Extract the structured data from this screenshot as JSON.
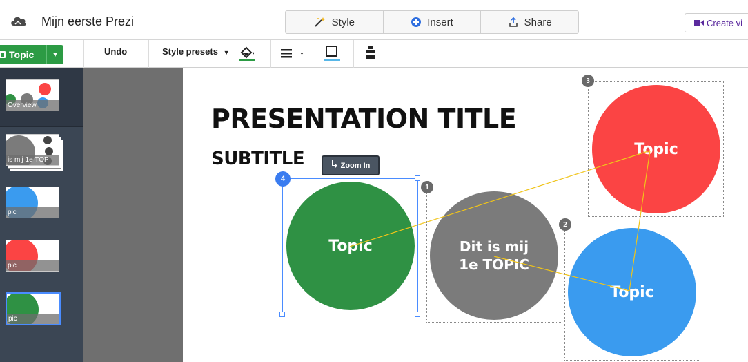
{
  "header": {
    "doc_title": "Mijn eerste Prezi",
    "modes": [
      {
        "label": "Style",
        "icon": "magic-wand-icon"
      },
      {
        "label": "Insert",
        "icon": "plus-circle-icon"
      },
      {
        "label": "Share",
        "icon": "share-upload-icon"
      }
    ],
    "create_video_label": "Create vi"
  },
  "toolbar": {
    "topic_label": "Topic",
    "undo_label": "Undo",
    "style_presets_label": "Style presets"
  },
  "sidebar": {
    "overview_label": "Overview",
    "items": [
      {
        "label": "is mij 1e TOP"
      },
      {
        "label": "pic"
      },
      {
        "label": "pic"
      },
      {
        "label": "pic"
      }
    ]
  },
  "slide": {
    "title": "PRESENTATION TITLE",
    "subtitle": "SUBTITLE",
    "zoom_in_label": "Zoom In"
  },
  "topics": [
    {
      "number": "1",
      "label": "Dit is mij 1e TOPIC",
      "color": "#7b7b7b"
    },
    {
      "number": "2",
      "label": "Topic",
      "color": "#3a9bef"
    },
    {
      "number": "3",
      "label": "Topic",
      "color": "#fb4444"
    },
    {
      "number": "4",
      "label": "Topic",
      "color": "#2f9144"
    }
  ],
  "colors": {
    "accent_green": "#2c9b44",
    "path_line": "#f0c419",
    "sidebar_bg": "#3b4654"
  }
}
